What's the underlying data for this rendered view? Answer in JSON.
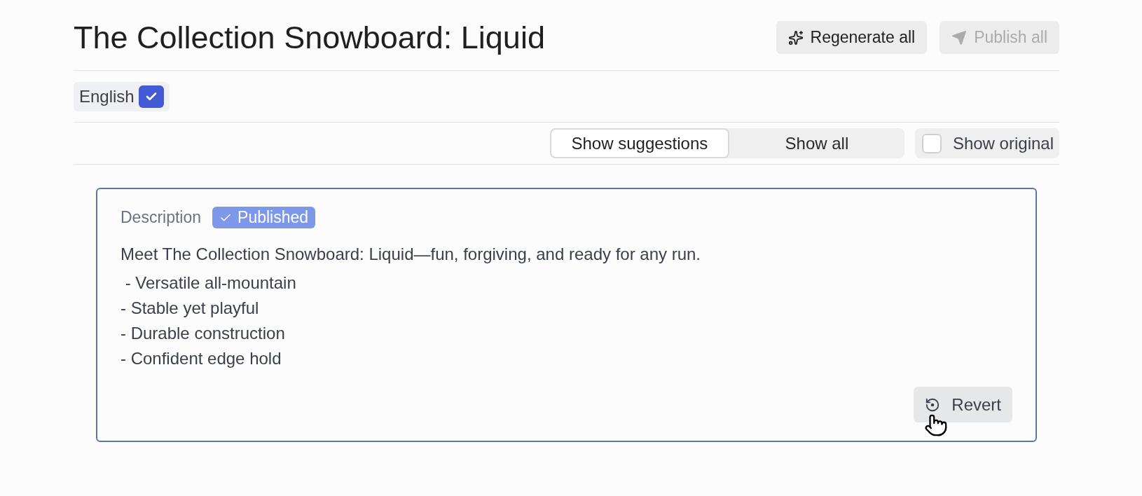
{
  "header": {
    "title": "The Collection Snowboard: Liquid",
    "buttons": [
      {
        "label": "Regenerate all",
        "kind": "regenerate",
        "disabled": false
      },
      {
        "label": "Publish all",
        "kind": "publish",
        "disabled": true
      }
    ]
  },
  "languages": [
    {
      "label": "English",
      "checked": true
    }
  ],
  "view_toggle": {
    "options": [
      {
        "label": "Show suggestions",
        "selected": true
      },
      {
        "label": "Show all",
        "selected": false
      }
    ]
  },
  "show_original": {
    "label": "Show original",
    "checked": false
  },
  "fields": [
    {
      "label": "Description",
      "status": {
        "label": "Published",
        "kind": "published"
      },
      "intro": "Meet The Collection Snowboard: Liquid—fun, forgiving, and ready for any run.",
      "lines": [
        " - Versatile all-mountain",
        "- Stable yet playful",
        "- Durable construction",
        "- Confident edge hold"
      ],
      "actions": [
        {
          "label": "Revert",
          "kind": "revert"
        }
      ]
    }
  ]
}
